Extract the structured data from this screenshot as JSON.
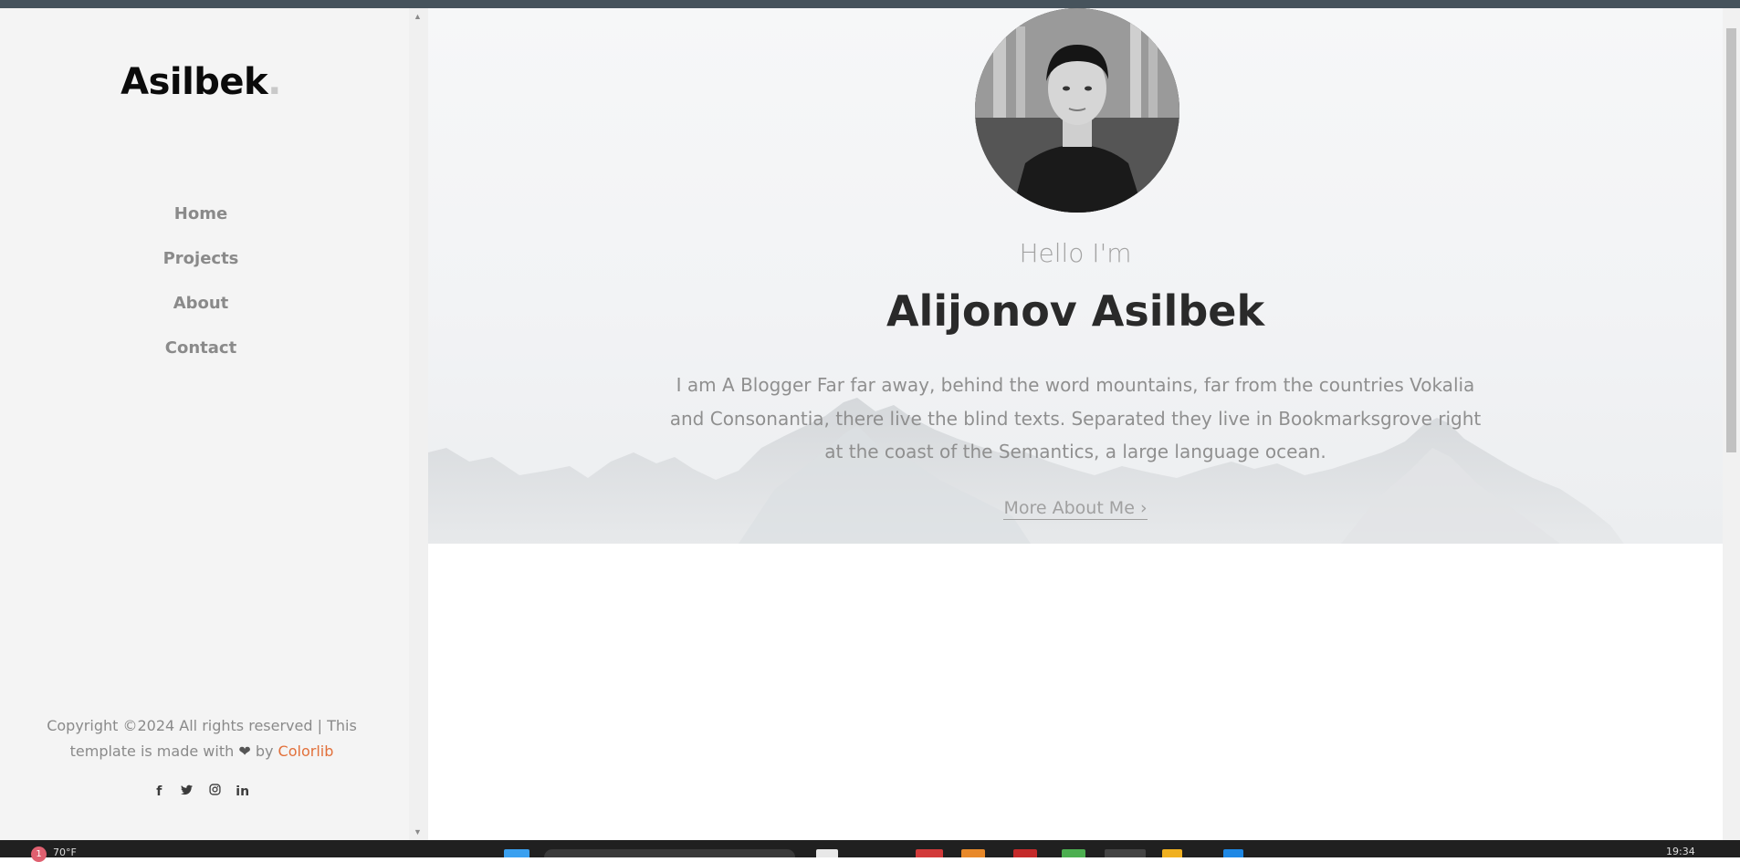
{
  "sidebar": {
    "logo": "Asilbek",
    "logo_dot": ".",
    "nav": [
      "Home",
      "Projects",
      "About",
      "Contact"
    ],
    "copyright_text": "Copyright ©2024 All rights reserved | This template is made with",
    "copyright_by": "by",
    "copyright_brand": "Colorlib",
    "social_icons": [
      "facebook-icon",
      "twitter-icon",
      "instagram-icon",
      "linkedin-icon"
    ]
  },
  "hero": {
    "greeting": "Hello I'm",
    "name": "Alijonov Asilbek",
    "bio": "I am A Blogger Far far away, behind the word mountains, far from the countries Vokalia and Consonantia, there live the blind texts. Separated they live in Bookmarksgrove right at the coast of the Semantics, a large language ocean.",
    "cta": "More About Me"
  },
  "taskbar": {
    "notification_count": "1",
    "temperature": "70°F",
    "time": "19:34"
  },
  "colors": {
    "topbar": "#46535c",
    "sidebar_bg": "#f4f4f4",
    "accent": "#e2703a",
    "taskbar": "#202020"
  }
}
